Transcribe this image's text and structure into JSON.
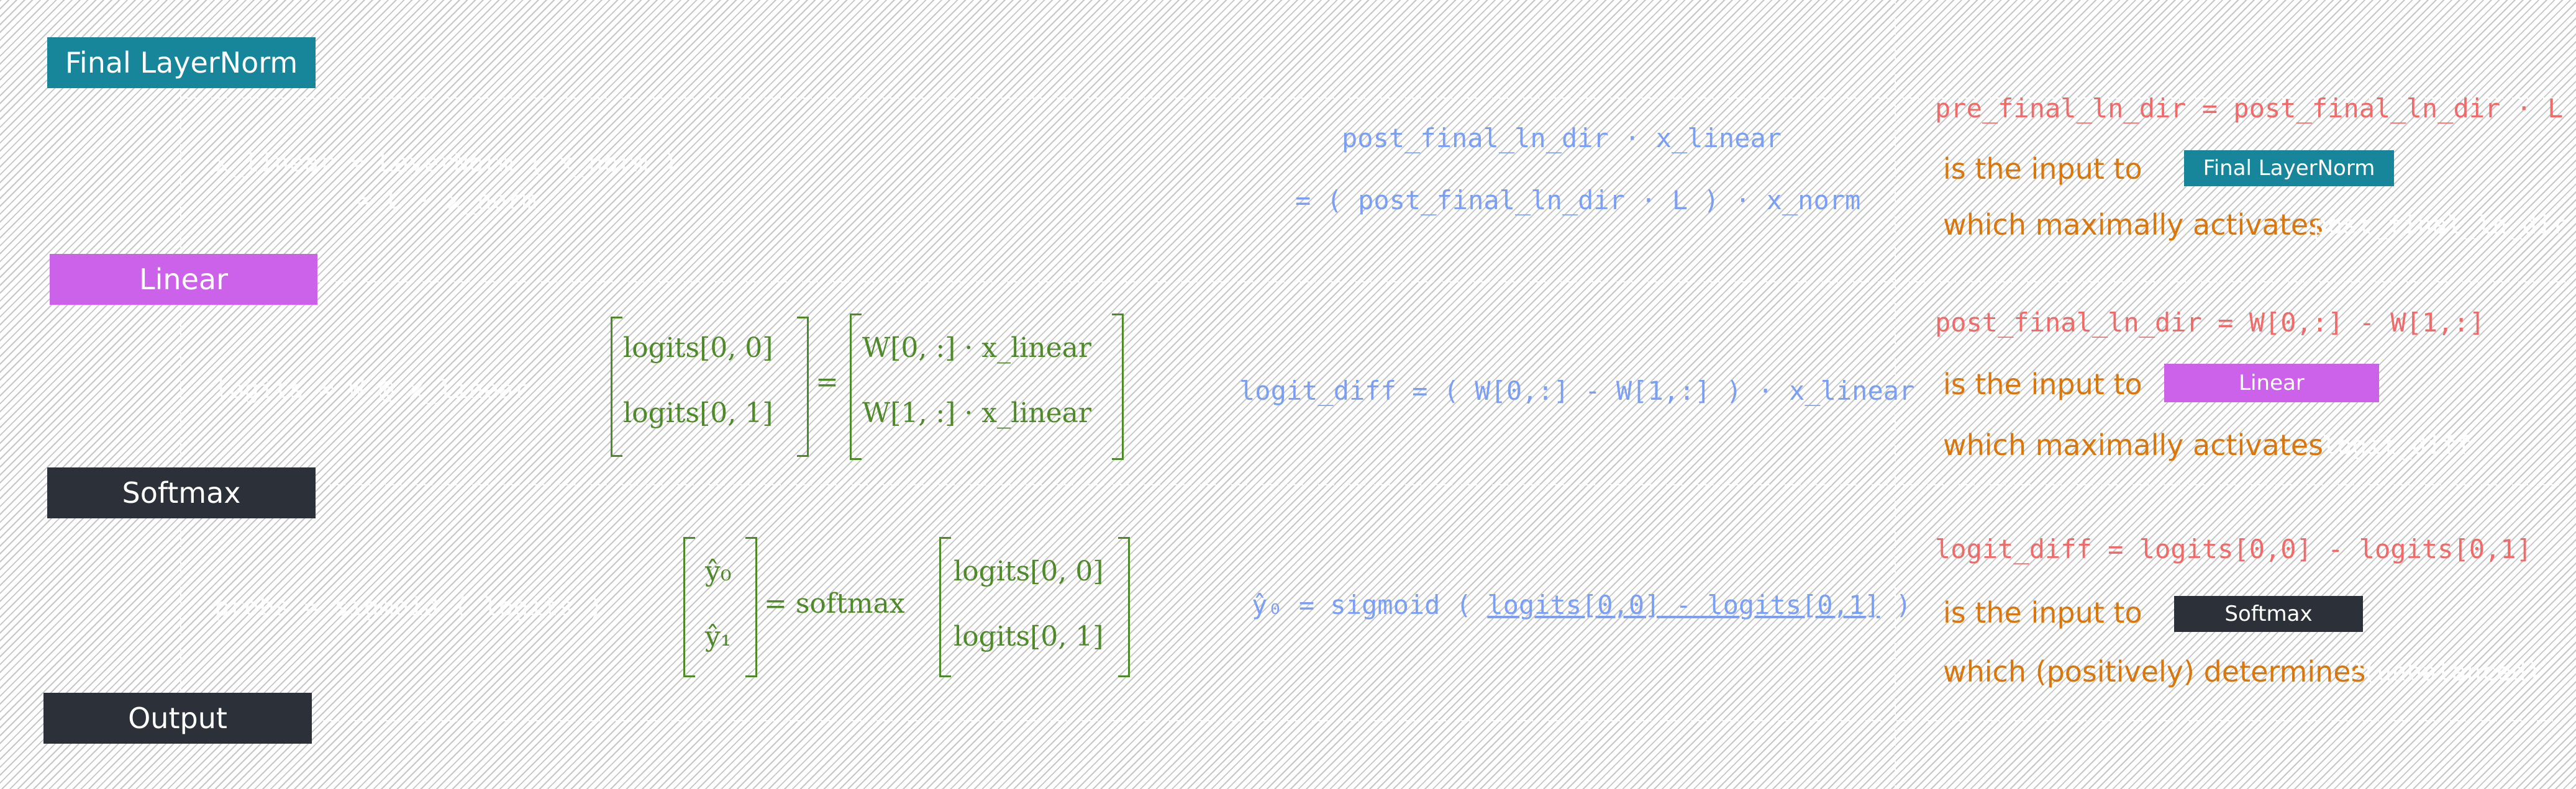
{
  "colors": {
    "final_layernorm": "#17869a",
    "linear": "#cd62ea",
    "softmax": "#2c3139",
    "output": "#2c3139",
    "math": "#4f8a2a",
    "blue": "#7b9ff5",
    "red": "#f06a6a",
    "orange": "#d9770c"
  },
  "blocks": {
    "final_layernorm": "Final LayerNorm",
    "linear": "Linear",
    "softmax": "Softmax",
    "output": "Output"
  },
  "code": {
    "layernorm_line1": "x_linear = LayerNorm ( x_norm )",
    "layernorm_line2": "= L · x_norm",
    "linear_line": "logits = W @ x_linear",
    "softmax_line": "probs = sigmoid ( logits )"
  },
  "math": {
    "logits_00": "logits[0, 0]",
    "logits_01": "logits[0, 1]",
    "eq": "=",
    "w0": "W[0, :] · x_linear",
    "w1": "W[1, :] · x_linear",
    "yhat0": "ŷ₀",
    "yhat1": "ŷ₁",
    "eq_softmax": "= softmax",
    "sm_logits_00": "logits[0, 0]",
    "sm_logits_01": "logits[0, 1]"
  },
  "blue": {
    "ln_line1": "post_final_ln_dir · x_linear",
    "ln_line2": "= ( post_final_ln_dir · L ) · x_norm",
    "linear_line": "logit_diff = ( W[0,:] - W[1,:] ) · x_linear",
    "softmax_prefix": "ŷ₀ = sigmoid (",
    "softmax_under": "logits[0,0] - logits[0,1]",
    "softmax_suffix": ")"
  },
  "right": {
    "ln_red": "pre_final_ln_dir = post_final_ln_dir · L",
    "ln_is_input": "is the input to",
    "ln_tag": "Final LayerNorm",
    "ln_which": "which maximally activates",
    "ln_faint": "post_final_ln_dir",
    "lin_red": "post_final_ln_dir = W[0,:] - W[1,:]",
    "lin_is_input": "is the input to",
    "lin_tag": "Linear",
    "lin_which": "which maximally activates",
    "lin_faint": "logit_diff",
    "sm_red": "logit_diff = logits[0,0] - logits[0,1]",
    "sm_is_input": "is the input to",
    "sm_tag": "Softmax",
    "sm_which": "which (positively) determines",
    "sm_faint": "P(unbalanced)"
  }
}
